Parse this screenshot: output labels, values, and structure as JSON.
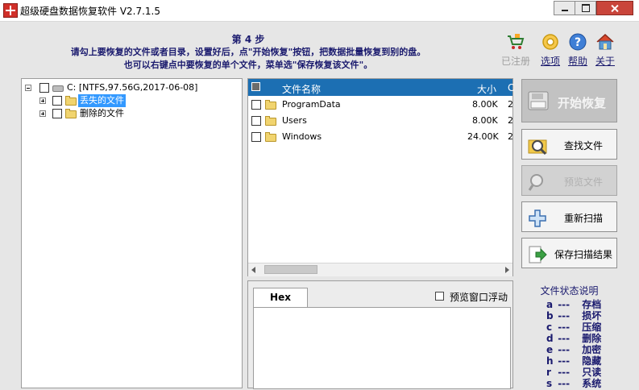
{
  "window": {
    "title": "超级硬盘数据恢复软件 V2.7.1.5"
  },
  "instructions": {
    "step": "第 4 步",
    "line1": "请勾上要恢复的文件或者目录，设置好后，点\"开始恢复\"按钮，把数据批量恢复到别的盘。",
    "line2": "也可以右键点中要恢复的单个文件，菜单选\"保存恢复该文件\"。"
  },
  "toolbar": {
    "registered": "已注册",
    "options": "选项",
    "help": "帮助",
    "about": "关于"
  },
  "tree": {
    "root": "C: [NTFS,97.56G,2017-06-08]",
    "lost_files": "丢失的文件",
    "deleted_files": "删除的文件"
  },
  "filelist": {
    "col_name": "文件名称",
    "col_size": "大小",
    "col_extra": "C",
    "rows": [
      {
        "name": "ProgramData",
        "size": "8.00K",
        "extra": "2"
      },
      {
        "name": "Users",
        "size": "8.00K",
        "extra": "2"
      },
      {
        "name": "Windows",
        "size": "24.00K",
        "extra": "2"
      }
    ]
  },
  "preview": {
    "hex_tab": "Hex",
    "float_label": "预览窗口浮动"
  },
  "buttons": {
    "start": "开始恢复",
    "find": "查找文件",
    "preview": "预览文件",
    "rescan": "重新扫描",
    "save_scan": "保存扫描结果"
  },
  "legend": {
    "title": "文件状态说明",
    "items": [
      {
        "key": "a",
        "dash": "---",
        "desc": "存档"
      },
      {
        "key": "b",
        "dash": "---",
        "desc": "损坏"
      },
      {
        "key": "c",
        "dash": "---",
        "desc": "压缩"
      },
      {
        "key": "d",
        "dash": "---",
        "desc": "删除"
      },
      {
        "key": "e",
        "dash": "---",
        "desc": "加密"
      },
      {
        "key": "h",
        "dash": "---",
        "desc": "隐藏"
      },
      {
        "key": "r",
        "dash": "---",
        "desc": "只读"
      },
      {
        "key": "s",
        "dash": "---",
        "desc": "系统"
      }
    ]
  },
  "colors": {
    "accent_header": "#1c6fb3",
    "text_dark_blue": "#1a1a6e",
    "selection": "#3399ff"
  }
}
